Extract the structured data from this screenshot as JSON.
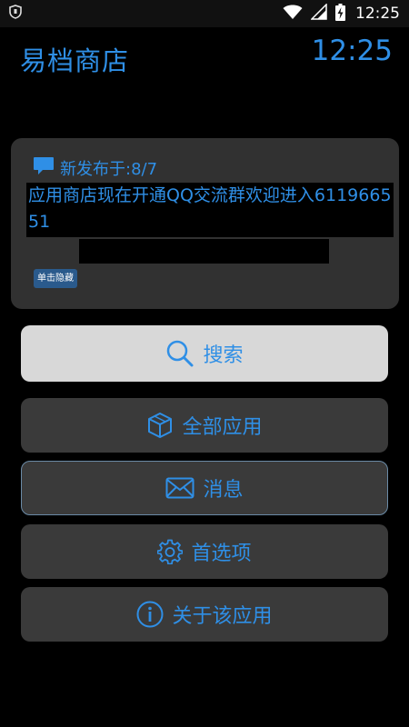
{
  "status_bar": {
    "time": "12:25",
    "icons": [
      "shield-icon",
      "wifi-icon",
      "signal-icon",
      "battery-charging-icon"
    ]
  },
  "header": {
    "title": "易档商店",
    "clock": "12:25"
  },
  "notice": {
    "icon": "chat-bubble-icon",
    "date_label": "新发布于:8/7",
    "message": "应用商店现在开通QQ交流群欢迎进入611966551",
    "hide_button": "单击隐藏"
  },
  "menu": {
    "search": {
      "label": "搜索",
      "icon": "search-icon"
    },
    "all_apps": {
      "label": "全部应用",
      "icon": "box-icon"
    },
    "messages": {
      "label": "消息",
      "icon": "envelope-icon"
    },
    "preferences": {
      "label": "首选项",
      "icon": "gear-icon"
    },
    "about": {
      "label": "关于该应用",
      "icon": "info-icon"
    }
  },
  "colors": {
    "accent": "#2f8fe6",
    "background": "#000000",
    "card": "#313131",
    "button": "#3a3a3a",
    "search_button": "#d8d8d8"
  }
}
